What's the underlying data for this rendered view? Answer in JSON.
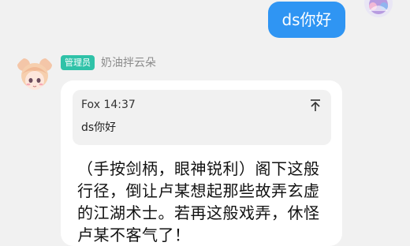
{
  "outgoing": {
    "text": "ds你好"
  },
  "incoming": {
    "role_badge": "管理员",
    "sender_name": "奶油拌云朵",
    "quote": {
      "author": "Fox",
      "time": "14:37",
      "text": "ds你好"
    },
    "reply_text": "（手按剑柄，眼神锐利）阁下这般行径，倒让卢某想起那些故弄玄虚的江湖术士。若再这般戏弄，休怪卢某不客气了！"
  },
  "icons": {
    "quote_jump": "jump-to-original-icon",
    "my_avatar": "avatar",
    "bot_avatar": "avatar"
  },
  "colors": {
    "my_bubble": "#2f95f3",
    "role_badge": "#2fc2a8",
    "page_bg": "#f1f1f1"
  }
}
